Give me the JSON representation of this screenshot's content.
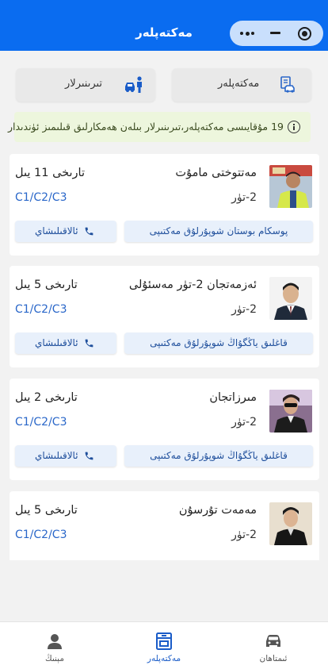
{
  "header": {
    "title": "مەكتەپلەر"
  },
  "tabs": [
    {
      "label": "مەكتەپلەر",
      "icon": "school-search-icon"
    },
    {
      "label": "تىرىنىرلار",
      "icon": "trainer-car-icon"
    }
  ],
  "notice": {
    "text": "19 مۇقايىسى مەكتەپلەر،تىرىنىرلار بىلەن ھەمكارلىق قىلىمىز ئۈندىدار",
    "icon": "info-icon"
  },
  "cards": [
    {
      "name": "مەتتوختى مامۇت",
      "grade": "2-تۈر",
      "experience": "تارىخى 11 يىل",
      "licenses": "C1/C2/C3",
      "school": "پوسكام بوستان شوپۇرلۇق مەكتىپى",
      "call_label": "ئالاقىلىشاي"
    },
    {
      "name": "ئەزمەتجان 2-تۈر مەسئۇلى",
      "grade": "2-تۈر",
      "experience": "تارىخى 5 يىل",
      "licenses": "C1/C2/C3",
      "school": "قاغلىق ياڭگۇاڭ شوپۇرلۇق مەكتىپى",
      "call_label": "ئالاقىلىشاي"
    },
    {
      "name": "مىرزاتجان",
      "grade": "2-تۈر",
      "experience": "تارىخى 2 يىل",
      "licenses": "C1/C2/C3",
      "school": "قاغلىق ياڭگۇاڭ شوپۇرلۇق مەكتىپى",
      "call_label": "ئالاقىلىشاي"
    },
    {
      "name": "مەمەت تۇرسۇن",
      "grade": "2-تۈر",
      "experience": "تارىخى 5 يىل",
      "licenses": "C1/C2/C3",
      "school": "",
      "call_label": ""
    }
  ],
  "bottom_nav": [
    {
      "label": "ئىمتاھان",
      "icon": "car-icon",
      "active": false
    },
    {
      "label": "مەكتەپلەر",
      "icon": "school-icon",
      "active": true
    },
    {
      "label": "مېنىڭ",
      "icon": "user-icon",
      "active": false
    }
  ],
  "colors": {
    "primary": "#0a6cf0",
    "license": "#2a67c9",
    "notice_bg": "#edf6dd"
  }
}
